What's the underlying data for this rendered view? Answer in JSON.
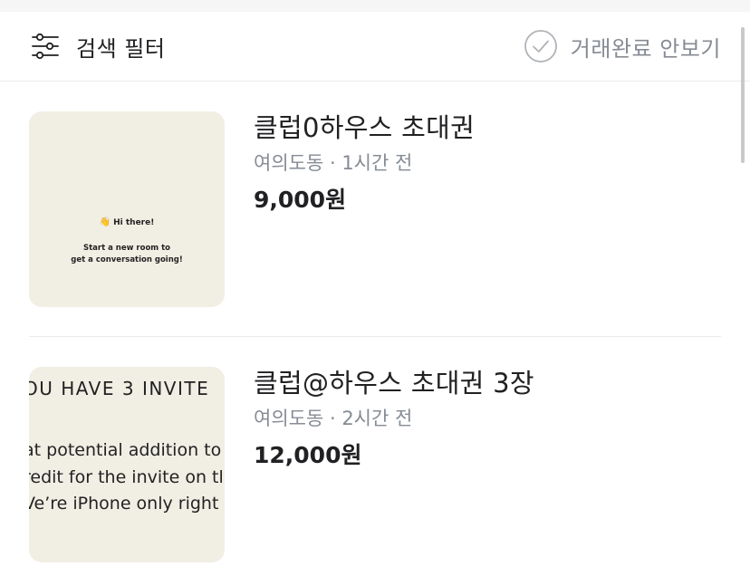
{
  "filter_bar": {
    "filter_label": "검색 필터",
    "hide_sold_label": "거래완료 안보기"
  },
  "icons": {
    "filter": "sliders-icon",
    "hide_sold": "check-circle-icon"
  },
  "colors": {
    "text_primary": "#212124",
    "text_secondary": "#868b94",
    "thumbnail_bg": "#f1eee4",
    "divider": "#e9ecef"
  },
  "items": [
    {
      "title": "클럽0하우스 초대권",
      "location": "여의도동",
      "separator": " · ",
      "time": "1시간 전",
      "price": "9,000원",
      "thumbnail": {
        "greeting": "Hi there!",
        "greeting_emoji": "👋",
        "message_line1": "Start a new room to",
        "message_line2": "get a conversation going!"
      }
    },
    {
      "title": "클럽@하우스 초대권 3장",
      "location": "여의도동",
      "separator": " · ",
      "time": "2시간 전",
      "price": "12,000원",
      "thumbnail": {
        "heading": "OU HAVE 3 INVITE",
        "line1": "at potential addition to",
        "line2": "redit for the invite on tl",
        "line3": "Ve’re iPhone only right"
      }
    }
  ]
}
